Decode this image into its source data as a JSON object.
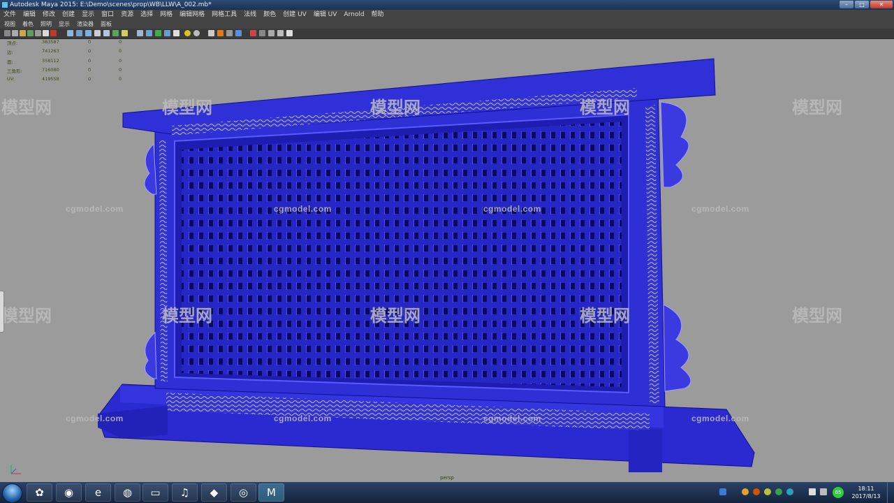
{
  "window": {
    "title": "Autodesk Maya 2015: E:\\Demo\\scenes\\prop\\WB\\LLW\\A_002.mb*"
  },
  "menu": [
    "文件",
    "编辑",
    "修改",
    "创建",
    "显示",
    "窗口",
    "资源",
    "选择",
    "网格",
    "编辑网格",
    "网格工具",
    "法线",
    "颜色",
    "创建 UV",
    "编辑 UV",
    "Arnold",
    "帮助"
  ],
  "panel_menu": [
    "视图",
    "着色",
    "照明",
    "显示",
    "渲染器",
    "面板"
  ],
  "hud": [
    {
      "label": "顶点:",
      "values": [
        "383587",
        "0",
        "0"
      ]
    },
    {
      "label": "边:",
      "values": [
        "741263",
        "0",
        "0"
      ]
    },
    {
      "label": "面:",
      "values": [
        "358112",
        "0",
        "0"
      ]
    },
    {
      "label": "三角形:",
      "values": [
        "716080",
        "0",
        "0"
      ]
    },
    {
      "label": "UV:",
      "values": [
        "419558",
        "0",
        "0"
      ]
    }
  ],
  "viewport": {
    "camera": "persp",
    "model_color": "#2f2fd6"
  },
  "watermarks": {
    "site": "cgmodel.com",
    "brand": "模型网"
  },
  "taskbar": {
    "time": "18:11",
    "date": "2017/8/13",
    "badge": "65"
  }
}
